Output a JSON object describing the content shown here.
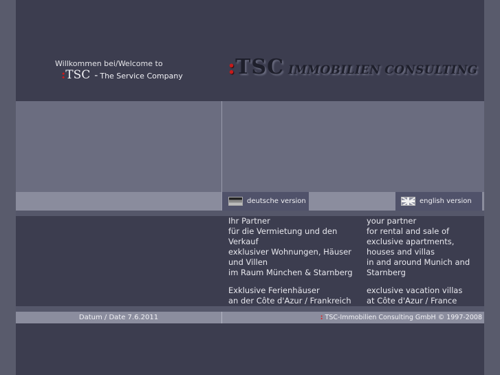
{
  "header": {
    "welcome": "Willkommen bei/Welcome to",
    "brand_colon": ":",
    "brand_tsc": "TSC",
    "brand_dash": "-",
    "brand_tagline": "The Service Company",
    "logo_colon": ":",
    "logo_name": "TSC",
    "logo_sub": "IMMOBILIEN CONSULTING"
  },
  "language": {
    "de_label": "deutsche version",
    "en_label": "english version",
    "de_icon": "german-flag-icon",
    "en_icon": "uk-flag-icon"
  },
  "content": {
    "de_p1": "Ihr Partner\nfür die Vermietung und den Verkauf\nexklusiver Wohnungen, Häuser und Villen\nim Raum München & Starnberg",
    "de_p2": "Exklusive Ferienhäuser\nan der Côte d'Azur / Frankreich",
    "en_p1": "your partner\nfor rental and sale of\nexclusive apartments, houses and villas\nin and around Munich and Starnberg",
    "en_p2": "exclusive vacation villas\nat Côte d'Azur / France"
  },
  "footer": {
    "date": "Datum / Date 7.6.2011",
    "copyright_colon": ":",
    "copyright": "TSC-Immobilien Consulting GmbH © 1997-2008"
  },
  "colors": {
    "accent": "#d01818",
    "page_bg": "#3c3d4f",
    "panel": "#6b6d80",
    "bar": "#8b8d9e"
  }
}
